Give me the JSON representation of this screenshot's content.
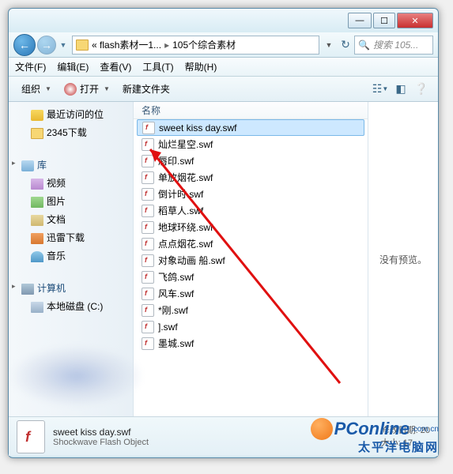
{
  "titlebar": {
    "min": "—",
    "max": "☐",
    "close": "✕"
  },
  "nav": {
    "crumb_prefix": "«",
    "crumb1": "flash素材一1...",
    "crumb2": "105个综合素材",
    "search_placeholder": "搜索 105..."
  },
  "menu": {
    "file": "文件(F)",
    "edit": "编辑(E)",
    "view": "查看(V)",
    "tools": "工具(T)",
    "help": "帮助(H)"
  },
  "toolbar": {
    "organize": "组织",
    "open": "打开",
    "newfolder": "新建文件夹"
  },
  "sidebar": {
    "recent": "最近访问的位",
    "downloads": "2345下载",
    "library": "库",
    "videos": "视频",
    "pictures": "图片",
    "documents": "文档",
    "xunlei": "迅雷下载",
    "music": "音乐",
    "computer": "计算机",
    "localdisk": "本地磁盘 (C:)"
  },
  "list": {
    "header": "名称",
    "items": [
      "sweet kiss day.swf",
      "灿烂星空.swf",
      "唇印.swf",
      "单放烟花.swf",
      "倒计时.swf",
      "稻草人.swf",
      "地球环绕.swf",
      "点点烟花.swf",
      "对象动画 船.swf",
      "飞鸽.swf",
      "风车.swf",
      "*刚.swf",
      "].swf",
      "墨城.swf"
    ]
  },
  "preview": {
    "none": "没有预览。"
  },
  "status": {
    "filename": "sweet kiss day.swf",
    "type": "Shockwave Flash Object",
    "moddate_label": "修改日期:",
    "moddate_val": "20",
    "size_label": "大小:",
    "size_val": "17."
  },
  "watermark": {
    "brand": "PConline",
    "suffix": ".com.cn",
    "cn": "太平洋电脑网"
  }
}
